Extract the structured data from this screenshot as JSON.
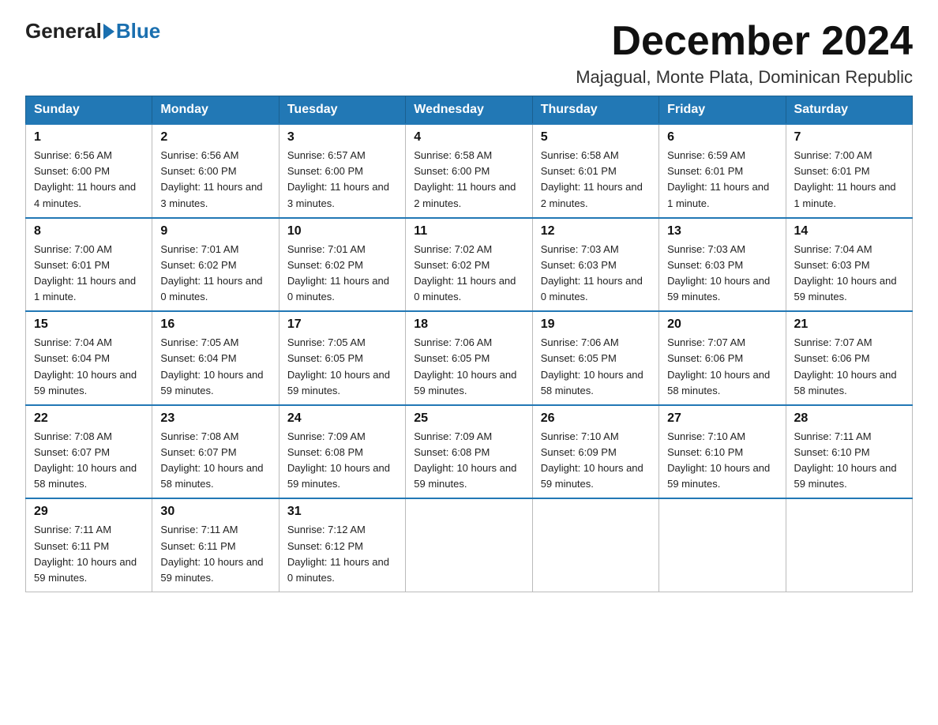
{
  "logo": {
    "general": "General",
    "blue": "Blue",
    "subtitle": ""
  },
  "header": {
    "month_title": "December 2024",
    "location": "Majagual, Monte Plata, Dominican Republic"
  },
  "weekdays": [
    "Sunday",
    "Monday",
    "Tuesday",
    "Wednesday",
    "Thursday",
    "Friday",
    "Saturday"
  ],
  "weeks": [
    [
      {
        "day": "1",
        "sunrise": "6:56 AM",
        "sunset": "6:00 PM",
        "daylight": "11 hours and 4 minutes."
      },
      {
        "day": "2",
        "sunrise": "6:56 AM",
        "sunset": "6:00 PM",
        "daylight": "11 hours and 3 minutes."
      },
      {
        "day": "3",
        "sunrise": "6:57 AM",
        "sunset": "6:00 PM",
        "daylight": "11 hours and 3 minutes."
      },
      {
        "day": "4",
        "sunrise": "6:58 AM",
        "sunset": "6:00 PM",
        "daylight": "11 hours and 2 minutes."
      },
      {
        "day": "5",
        "sunrise": "6:58 AM",
        "sunset": "6:01 PM",
        "daylight": "11 hours and 2 minutes."
      },
      {
        "day": "6",
        "sunrise": "6:59 AM",
        "sunset": "6:01 PM",
        "daylight": "11 hours and 1 minute."
      },
      {
        "day": "7",
        "sunrise": "7:00 AM",
        "sunset": "6:01 PM",
        "daylight": "11 hours and 1 minute."
      }
    ],
    [
      {
        "day": "8",
        "sunrise": "7:00 AM",
        "sunset": "6:01 PM",
        "daylight": "11 hours and 1 minute."
      },
      {
        "day": "9",
        "sunrise": "7:01 AM",
        "sunset": "6:02 PM",
        "daylight": "11 hours and 0 minutes."
      },
      {
        "day": "10",
        "sunrise": "7:01 AM",
        "sunset": "6:02 PM",
        "daylight": "11 hours and 0 minutes."
      },
      {
        "day": "11",
        "sunrise": "7:02 AM",
        "sunset": "6:02 PM",
        "daylight": "11 hours and 0 minutes."
      },
      {
        "day": "12",
        "sunrise": "7:03 AM",
        "sunset": "6:03 PM",
        "daylight": "11 hours and 0 minutes."
      },
      {
        "day": "13",
        "sunrise": "7:03 AM",
        "sunset": "6:03 PM",
        "daylight": "10 hours and 59 minutes."
      },
      {
        "day": "14",
        "sunrise": "7:04 AM",
        "sunset": "6:03 PM",
        "daylight": "10 hours and 59 minutes."
      }
    ],
    [
      {
        "day": "15",
        "sunrise": "7:04 AM",
        "sunset": "6:04 PM",
        "daylight": "10 hours and 59 minutes."
      },
      {
        "day": "16",
        "sunrise": "7:05 AM",
        "sunset": "6:04 PM",
        "daylight": "10 hours and 59 minutes."
      },
      {
        "day": "17",
        "sunrise": "7:05 AM",
        "sunset": "6:05 PM",
        "daylight": "10 hours and 59 minutes."
      },
      {
        "day": "18",
        "sunrise": "7:06 AM",
        "sunset": "6:05 PM",
        "daylight": "10 hours and 59 minutes."
      },
      {
        "day": "19",
        "sunrise": "7:06 AM",
        "sunset": "6:05 PM",
        "daylight": "10 hours and 58 minutes."
      },
      {
        "day": "20",
        "sunrise": "7:07 AM",
        "sunset": "6:06 PM",
        "daylight": "10 hours and 58 minutes."
      },
      {
        "day": "21",
        "sunrise": "7:07 AM",
        "sunset": "6:06 PM",
        "daylight": "10 hours and 58 minutes."
      }
    ],
    [
      {
        "day": "22",
        "sunrise": "7:08 AM",
        "sunset": "6:07 PM",
        "daylight": "10 hours and 58 minutes."
      },
      {
        "day": "23",
        "sunrise": "7:08 AM",
        "sunset": "6:07 PM",
        "daylight": "10 hours and 58 minutes."
      },
      {
        "day": "24",
        "sunrise": "7:09 AM",
        "sunset": "6:08 PM",
        "daylight": "10 hours and 59 minutes."
      },
      {
        "day": "25",
        "sunrise": "7:09 AM",
        "sunset": "6:08 PM",
        "daylight": "10 hours and 59 minutes."
      },
      {
        "day": "26",
        "sunrise": "7:10 AM",
        "sunset": "6:09 PM",
        "daylight": "10 hours and 59 minutes."
      },
      {
        "day": "27",
        "sunrise": "7:10 AM",
        "sunset": "6:10 PM",
        "daylight": "10 hours and 59 minutes."
      },
      {
        "day": "28",
        "sunrise": "7:11 AM",
        "sunset": "6:10 PM",
        "daylight": "10 hours and 59 minutes."
      }
    ],
    [
      {
        "day": "29",
        "sunrise": "7:11 AM",
        "sunset": "6:11 PM",
        "daylight": "10 hours and 59 minutes."
      },
      {
        "day": "30",
        "sunrise": "7:11 AM",
        "sunset": "6:11 PM",
        "daylight": "10 hours and 59 minutes."
      },
      {
        "day": "31",
        "sunrise": "7:12 AM",
        "sunset": "6:12 PM",
        "daylight": "11 hours and 0 minutes."
      },
      null,
      null,
      null,
      null
    ]
  ]
}
